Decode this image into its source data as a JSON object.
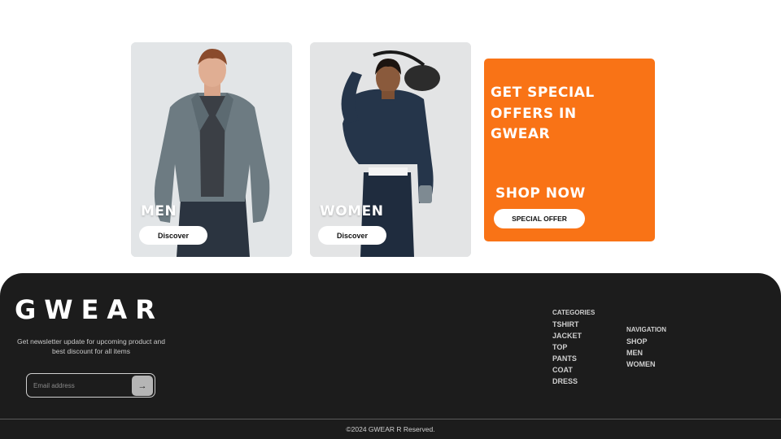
{
  "cards": [
    {
      "title": "MEN",
      "button": "Discover"
    },
    {
      "title": "WOMEN",
      "button": "Discover"
    }
  ],
  "offer": {
    "title": "GET SPECIAL OFFERS IN GWEAR",
    "shop_now": "SHOP NOW",
    "button": "SPECIAL OFFER",
    "color": "#f97316"
  },
  "footer": {
    "brand": "GWEAR",
    "tagline": "Get newsletter update for upcoming product and best discount for all items",
    "email_placeholder": "Email address",
    "submit_icon": "arrow-right-icon",
    "submit_glyph": "→",
    "categories": {
      "heading": "CATEGORIES",
      "items": [
        "TSHIRT",
        "JACKET",
        "TOP",
        "PANTS",
        "COAT",
        "DRESS"
      ]
    },
    "navigation": {
      "heading": "NAVIGATION",
      "items": [
        "SHOP",
        "MEN",
        "WOMEN"
      ]
    },
    "copyright": "©2024 GWEAR R Reserved.",
    "background": "#1c1c1c"
  }
}
